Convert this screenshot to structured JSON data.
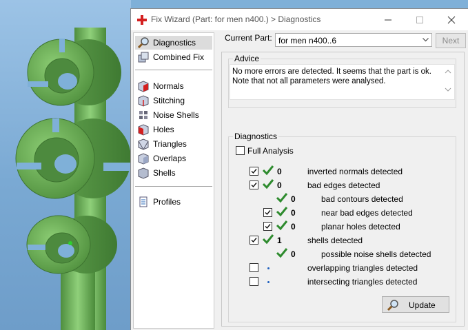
{
  "window": {
    "title": "Fix Wizard (Part: for men n400.) > Diagnostics"
  },
  "sidebar": {
    "items": [
      {
        "label": "Diagnostics",
        "icon": "magnifier-icon"
      },
      {
        "label": "Combined Fix",
        "icon": "cube-stack-icon"
      },
      {
        "label": "Normals",
        "icon": "normals-cube-icon"
      },
      {
        "label": "Stitching",
        "icon": "stitching-cube-icon"
      },
      {
        "label": "Noise Shells",
        "icon": "noise-shells-icon"
      },
      {
        "label": "Holes",
        "icon": "holes-cube-icon"
      },
      {
        "label": "Triangles",
        "icon": "triangles-cube-icon"
      },
      {
        "label": "Overlaps",
        "icon": "overlaps-cube-icon"
      },
      {
        "label": "Shells",
        "icon": "shells-cube-icon"
      },
      {
        "label": "Profiles",
        "icon": "document-icon"
      }
    ],
    "selected": "Diagnostics"
  },
  "current_part": {
    "label": "Current Part:",
    "value": "for men n400..6"
  },
  "next_label": "Next",
  "advice": {
    "legend": "Advice",
    "line1": "No more errors are detected. It seems that the part is ok.",
    "line2": "Note that not all parameters were analysed."
  },
  "diagnostics": {
    "legend": "Diagnostics",
    "full_analysis_label": "Full Analysis",
    "rows": [
      {
        "checkbox": true,
        "status": "ok",
        "count": "0",
        "label": "inverted normals detected",
        "indent": 0
      },
      {
        "checkbox": true,
        "status": "ok",
        "count": "0",
        "label": "bad edges detected",
        "indent": 0
      },
      {
        "checkbox": null,
        "status": "ok",
        "count": "0",
        "label": "bad contours detected",
        "indent": 1
      },
      {
        "checkbox": true,
        "status": "ok",
        "count": "0",
        "label": "near bad edges detected",
        "indent": 1
      },
      {
        "checkbox": true,
        "status": "ok",
        "count": "0",
        "label": "planar holes detected",
        "indent": 1
      },
      {
        "checkbox": true,
        "status": "ok",
        "count": "1",
        "label": "shells detected",
        "indent": 0
      },
      {
        "checkbox": null,
        "status": "ok",
        "count": "0",
        "label": "possible noise shells detected",
        "indent": 1
      },
      {
        "checkbox": false,
        "status": "pending",
        "count": "",
        "label": "overlapping triangles detected",
        "indent": 0
      },
      {
        "checkbox": false,
        "status": "pending",
        "count": "",
        "label": "intersecting triangles detected",
        "indent": 0
      }
    ],
    "update_label": "Update"
  },
  "colors": {
    "model_green": "#6db25a",
    "check_green": "#2e8b2e",
    "accent_blue": "#1f5fbf"
  }
}
